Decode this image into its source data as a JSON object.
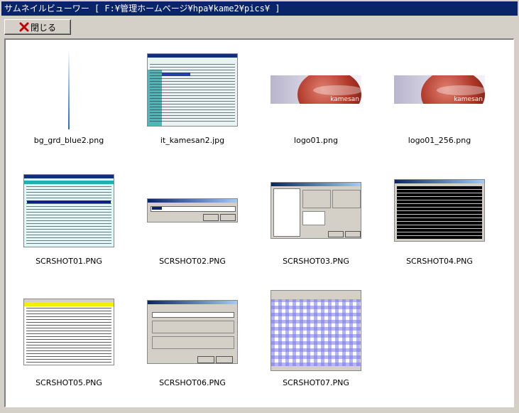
{
  "window": {
    "title": "サムネイルビューワー [ F:¥管理ホームページ¥hpa¥kame2¥pics¥ ]"
  },
  "toolbar": {
    "close_label": "閉じる",
    "close_icon": "close-x-icon",
    "close_icon_color": "#c00000"
  },
  "thumbnails": [
    {
      "filename": "bg_grd_blue2.png"
    },
    {
      "filename": "it_kamesan2.jpg"
    },
    {
      "filename": "logo01.png",
      "watermark": "kamesan"
    },
    {
      "filename": "logo01_256.png",
      "watermark": "kamesan"
    },
    {
      "filename": "SCRSHOT01.PNG"
    },
    {
      "filename": "SCRSHOT02.PNG"
    },
    {
      "filename": "SCRSHOT03.PNG"
    },
    {
      "filename": "SCRSHOT04.PNG"
    },
    {
      "filename": "SCRSHOT05.PNG"
    },
    {
      "filename": "SCRSHOT06.PNG"
    },
    {
      "filename": "SCRSHOT07.PNG"
    }
  ],
  "colors": {
    "titlebar": "#0a246a",
    "panel_background": "#ffffff",
    "window_background": "#d4d0c8"
  }
}
